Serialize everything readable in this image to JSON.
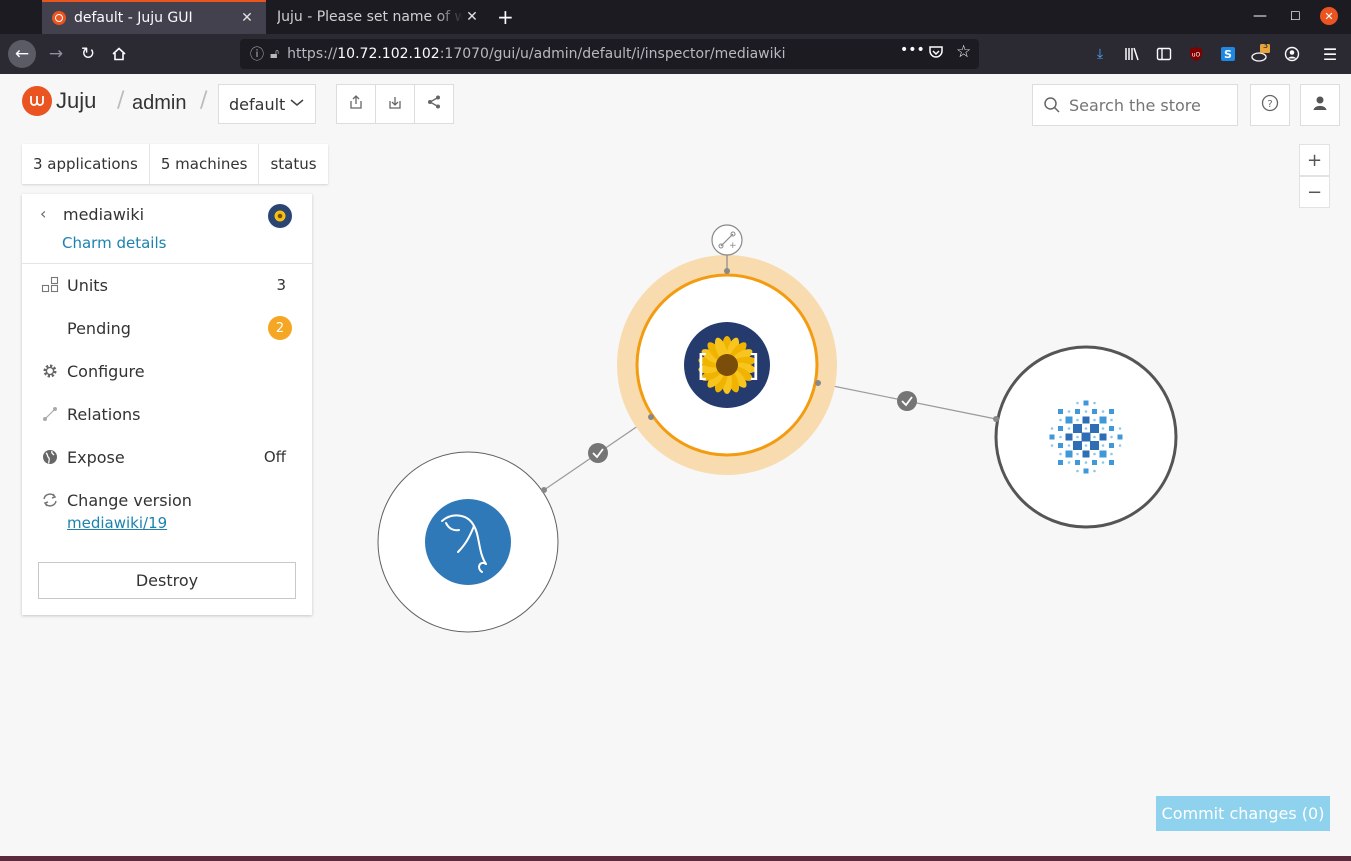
{
  "browser": {
    "tabs": [
      {
        "title": "default - Juju GUI",
        "active": true
      },
      {
        "title": "Juju - Please set name of wiki",
        "active": false
      }
    ],
    "url": {
      "scheme": "https://",
      "host": "10.72.102.102",
      "rest": ":17070/gui/u/admin/default/i/inspector/mediawiki"
    },
    "notification_badge": "3"
  },
  "header": {
    "logo_text": "Juju",
    "separator": "/",
    "user": "admin",
    "model": "default",
    "search_placeholder": "Search the store"
  },
  "counts": {
    "applications": "3 applications",
    "machines": "5 machines",
    "status": "status"
  },
  "inspector": {
    "back": "‹",
    "title": "mediawiki",
    "charm_details": "Charm details",
    "units_label": "Units",
    "units_value": "3",
    "pending_label": "Pending",
    "pending_value": "2",
    "configure_label": "Configure",
    "relations_label": "Relations",
    "expose_label": "Expose",
    "expose_value": "Off",
    "change_version_label": "Change version",
    "version_link": "mediawiki/19",
    "destroy": "Destroy"
  },
  "zoom": {
    "in": "+",
    "out": "−"
  },
  "commit": "Commit changes (0)",
  "colors": {
    "juju_orange": "#e95420",
    "link": "#1c82b0",
    "selected_ring": "#f39c12",
    "selected_halo": "#f8dcb0",
    "pending_badge": "#f5a623",
    "commit_disabled": "#8fd2ed",
    "mysql_blue": "#2f79b9",
    "mediawiki_navy": "#253b6e"
  },
  "canvas": {
    "applications": [
      {
        "name": "mediawiki",
        "icon": "sunflower-icon",
        "selected": true
      },
      {
        "name": "mysql",
        "icon": "dolphin-icon",
        "selected": false
      },
      {
        "name": "memcached",
        "icon": "grid-icon",
        "selected": false
      }
    ],
    "relations": [
      {
        "from": "mediawiki",
        "to": "mysql",
        "status": "ok"
      },
      {
        "from": "mediawiki",
        "to": "memcached",
        "status": "ok"
      }
    ]
  }
}
